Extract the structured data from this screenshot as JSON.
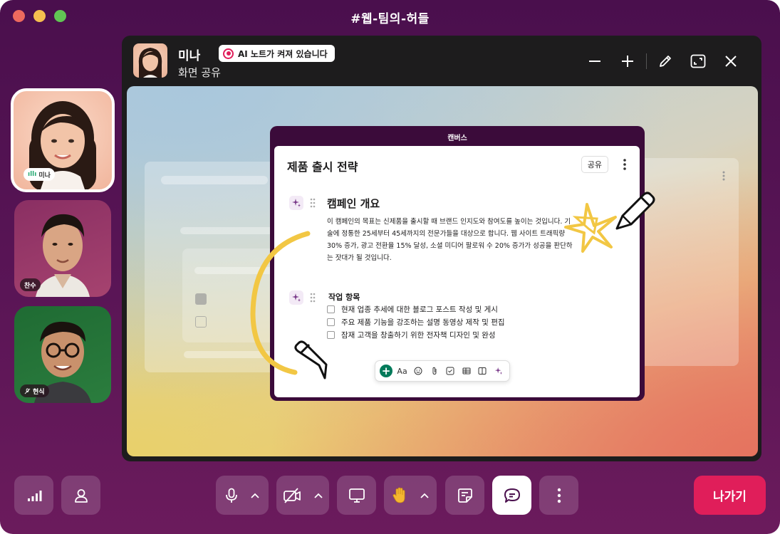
{
  "window": {
    "title": "#웹-팀의-허들"
  },
  "participants": [
    {
      "name": "미나",
      "status_icon": "audio-wave-icon",
      "active_speaker": true
    },
    {
      "name": "찬수"
    },
    {
      "name": "현식",
      "status_icon": "mic-off-icon"
    }
  ],
  "stage": {
    "presenter_name": "미나",
    "presenter_status": "화면 공유",
    "ai_badge": "AI 노트가 켜져 있습니다",
    "tools": [
      "minimize-icon",
      "zoom-in-icon",
      "pencil-icon",
      "fullscreen-icon",
      "close-icon"
    ]
  },
  "canvas": {
    "label": "캔버스",
    "title": "제품 출시 전략",
    "share_label": "공유",
    "section1": {
      "heading": "캠페인 개요",
      "body": "이 캠페인의 목표는 신제품을 출시할 때 브랜드 인지도와 참여도를 높이는 것입니다. 기술에 정통한 25세부터 45세까지의 전문가들을 대상으로 합니다. 웹 사이트 트래픽량 30% 증가, 광고 전환율 15% 달성, 소셜 미디어 팔로워 수 20% 증가가 성공을 판단하는 잣대가 될 것입니다."
    },
    "section2": {
      "heading": "작업 항목",
      "tasks": [
        "현재 업종 추세에 대한 블로그 포스트 작성 및 게시",
        "주요 제품 기능을 강조하는 설명 동영상 제작 및 편집",
        "잠재 고객을 창출하기 위한 전자책 디자인 및 완성"
      ]
    },
    "toolbar": {
      "text_label": "Aa"
    }
  },
  "controls": {
    "leave_label": "나가기",
    "buttons": [
      "signal-icon",
      "person-icon",
      "mic-icon",
      "video-off-icon",
      "screen-share-icon",
      "raise-hand-icon",
      "canvas-note-icon",
      "chat-bubble-icon",
      "more-icon"
    ]
  },
  "colors": {
    "window_bg": "#4a0f4d",
    "leave": "#e01e5a",
    "annotation_yellow": "#f2c744",
    "canvas_frame": "#3b0b3a"
  }
}
